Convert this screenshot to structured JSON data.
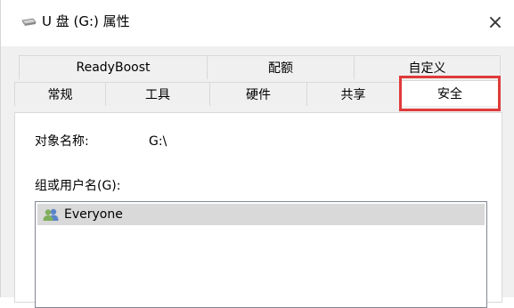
{
  "window": {
    "title": "U 盘 (G:) 属性",
    "close_glyph": "×"
  },
  "tabs_top": [
    {
      "label": "ReadyBoost"
    },
    {
      "label": "配额"
    },
    {
      "label": "自定义"
    }
  ],
  "tabs_bottom": [
    {
      "label": "常规"
    },
    {
      "label": "工具"
    },
    {
      "label": "硬件"
    },
    {
      "label": "共享"
    },
    {
      "label": "安全",
      "active": true
    }
  ],
  "security": {
    "object_name_label": "对象名称:",
    "object_name_value": "G:\\",
    "groups_label": "组或用户名(G):",
    "users": [
      {
        "name": "Everyone",
        "icon": "users-icon"
      }
    ]
  },
  "colors": {
    "highlight": "#e03a3a",
    "selection": "#d9d9d9"
  }
}
